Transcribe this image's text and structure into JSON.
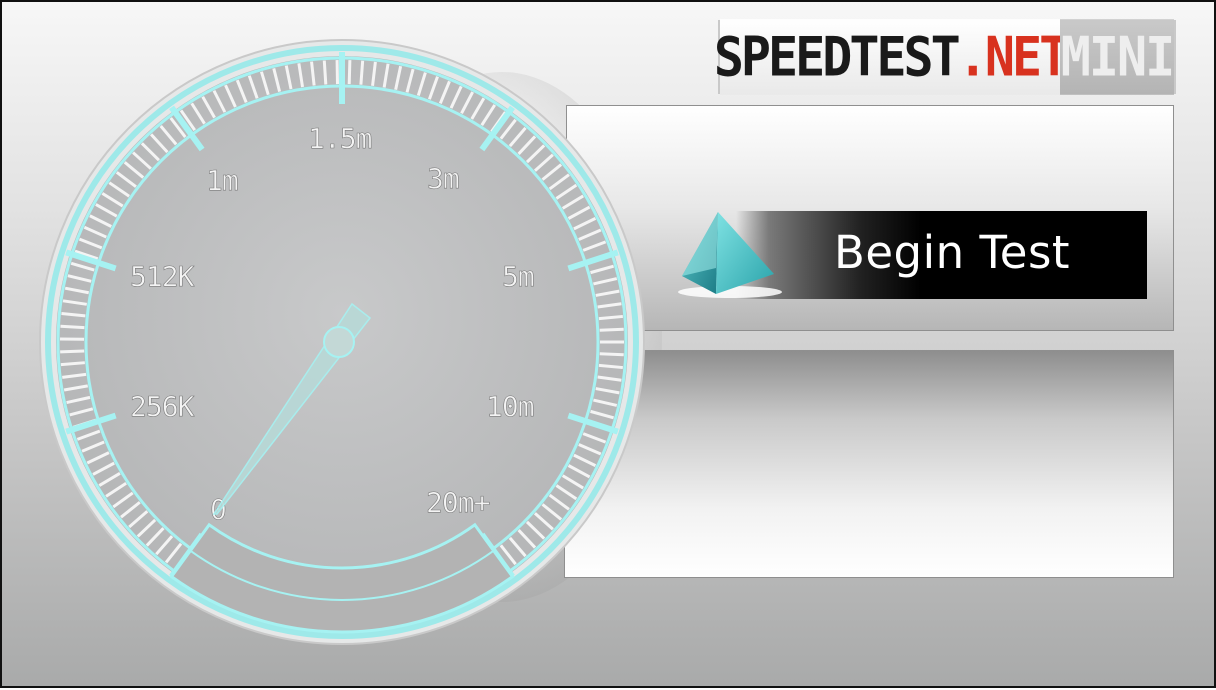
{
  "app": {
    "logo_speedtest": "SPEEDTEST",
    "logo_dot_net": ".NET",
    "logo_mini": "MINI"
  },
  "gauge": {
    "labels": [
      "0",
      "256K",
      "512K",
      "1m",
      "1.5m",
      "3m",
      "5m",
      "10m",
      "20m+"
    ],
    "needle_value": "0",
    "accent": "#a6f2f2"
  },
  "actions": {
    "begin_test": "Begin Test"
  },
  "colors": {
    "accent_red": "#d8321f",
    "gauge_teal": "#a6f2f2",
    "button_black": "#000000"
  }
}
